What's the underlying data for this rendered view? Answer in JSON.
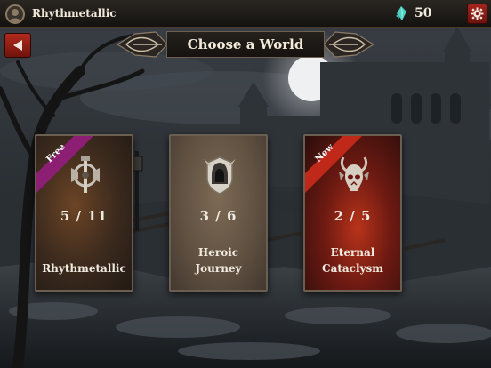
{
  "player": {
    "name": "Rhythmetallic"
  },
  "currency": {
    "gems": "50",
    "icon": "gem-icon",
    "color": "#5fd3c8"
  },
  "header": {
    "title": "Choose a World"
  },
  "worlds": [
    {
      "name": "Rhythmetallic",
      "progress": "5 / 11",
      "badge": "Free",
      "badge_color": "#8c1f73",
      "emblem": "guitar-emblem-icon"
    },
    {
      "name_line1": "Heroic",
      "name_line2": "Journey",
      "progress": "3 / 6",
      "emblem": "hooded-hero-emblem-icon"
    },
    {
      "name_line1": "Eternal",
      "name_line2": "Cataclysm",
      "progress": "2 / 5",
      "badge": "New",
      "badge_color": "#c0281a",
      "emblem": "demon-skull-emblem-icon"
    }
  ]
}
